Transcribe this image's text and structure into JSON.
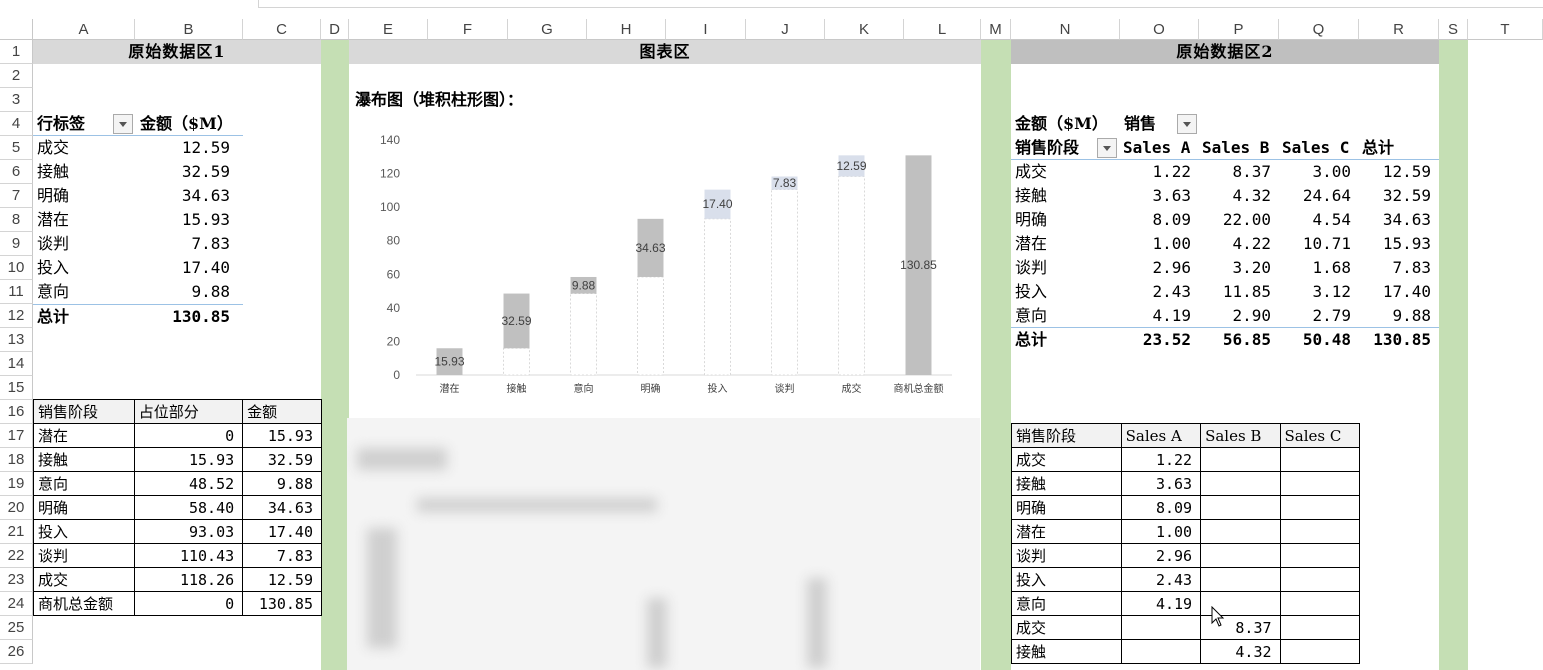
{
  "columns": [
    "A",
    "B",
    "C",
    "D",
    "E",
    "F",
    "G",
    "H",
    "I",
    "J",
    "K",
    "L",
    "M",
    "N",
    "O",
    "P",
    "Q",
    "R",
    "S",
    "T"
  ],
  "rows": [
    "1",
    "2",
    "3",
    "4",
    "5",
    "6",
    "7",
    "8",
    "9",
    "10",
    "11",
    "12",
    "13",
    "14",
    "15",
    "16",
    "17",
    "18",
    "19",
    "20",
    "21",
    "22",
    "23",
    "24",
    "25",
    "26"
  ],
  "headers": {
    "left": "原始数据区1",
    "middle": "图表区",
    "right": "原始数据区2"
  },
  "pivot1": {
    "col1": "行标签",
    "col2": "金额（$M）",
    "rows": [
      {
        "label": "成交",
        "value": "12.59"
      },
      {
        "label": "接触",
        "value": "32.59"
      },
      {
        "label": "明确",
        "value": "34.63"
      },
      {
        "label": "潜在",
        "value": "15.93"
      },
      {
        "label": "谈判",
        "value": "7.83"
      },
      {
        "label": "投入",
        "value": "17.40"
      },
      {
        "label": "意向",
        "value": "9.88"
      }
    ],
    "total_label": "总计",
    "total_value": "130.85"
  },
  "table1": {
    "headers": [
      "销售阶段",
      "占位部分",
      "金额"
    ],
    "rows": [
      [
        "潜在",
        "0",
        "15.93"
      ],
      [
        "接触",
        "15.93",
        "32.59"
      ],
      [
        "意向",
        "48.52",
        "9.88"
      ],
      [
        "明确",
        "58.40",
        "34.63"
      ],
      [
        "投入",
        "93.03",
        "17.40"
      ],
      [
        "谈判",
        "110.43",
        "7.83"
      ],
      [
        "成交",
        "118.26",
        "12.59"
      ],
      [
        "商机总金额",
        "0",
        "130.85"
      ]
    ]
  },
  "pivot2": {
    "corner": "金额（$M）",
    "col_field": "销售",
    "row_field": "销售阶段",
    "col_headers": [
      "Sales A",
      "Sales B",
      "Sales C",
      "总计"
    ],
    "rows": [
      {
        "label": "成交",
        "values": [
          "1.22",
          "8.37",
          "3.00",
          "12.59"
        ]
      },
      {
        "label": "接触",
        "values": [
          "3.63",
          "4.32",
          "24.64",
          "32.59"
        ]
      },
      {
        "label": "明确",
        "values": [
          "8.09",
          "22.00",
          "4.54",
          "34.63"
        ]
      },
      {
        "label": "潜在",
        "values": [
          "1.00",
          "4.22",
          "10.71",
          "15.93"
        ]
      },
      {
        "label": "谈判",
        "values": [
          "2.96",
          "3.20",
          "1.68",
          "7.83"
        ]
      },
      {
        "label": "投入",
        "values": [
          "2.43",
          "11.85",
          "3.12",
          "17.40"
        ]
      },
      {
        "label": "意向",
        "values": [
          "4.19",
          "2.90",
          "2.79",
          "9.88"
        ]
      }
    ],
    "total_label": "总计",
    "totals": [
      "23.52",
      "56.85",
      "50.48",
      "130.85"
    ]
  },
  "table2": {
    "headers": [
      "销售阶段",
      "Sales A",
      "Sales B",
      "Sales C"
    ],
    "rows": [
      [
        "成交",
        "1.22",
        "",
        ""
      ],
      [
        "接触",
        "3.63",
        "",
        ""
      ],
      [
        "明确",
        "8.09",
        "",
        ""
      ],
      [
        "潜在",
        "1.00",
        "",
        ""
      ],
      [
        "谈判",
        "2.96",
        "",
        ""
      ],
      [
        "投入",
        "2.43",
        "",
        ""
      ],
      [
        "意向",
        "4.19",
        "",
        ""
      ],
      [
        "成交",
        "",
        "8.37",
        ""
      ],
      [
        "接触",
        "",
        "4.32",
        ""
      ]
    ]
  },
  "chart_data": {
    "type": "bar",
    "title": "瀑布图（堆积柱形图）：",
    "categories": [
      "潜在",
      "接触",
      "意向",
      "明确",
      "投入",
      "谈判",
      "成交",
      "商机总金额"
    ],
    "series": [
      {
        "values": [
          0,
          15.93,
          48.52,
          58.4,
          93.03,
          110.43,
          118.26,
          0
        ]
      },
      {
        "values": [
          15.93,
          32.59,
          9.88,
          34.63,
          17.4,
          7.83,
          12.59,
          130.85
        ]
      }
    ],
    "data_labels": [
      "15.93",
      "32.59",
      "9.88",
      "34.63",
      "17.40",
      "7.83",
      "12.59",
      "130.85"
    ],
    "ylim": [
      0,
      140
    ],
    "yticks": [
      "0",
      "20",
      "40",
      "60",
      "80",
      "100",
      "120",
      "140"
    ],
    "colors": {
      "increase": "#c0c0c0",
      "highlight": "#d9dfeb",
      "total": "#c0c0c0"
    }
  }
}
